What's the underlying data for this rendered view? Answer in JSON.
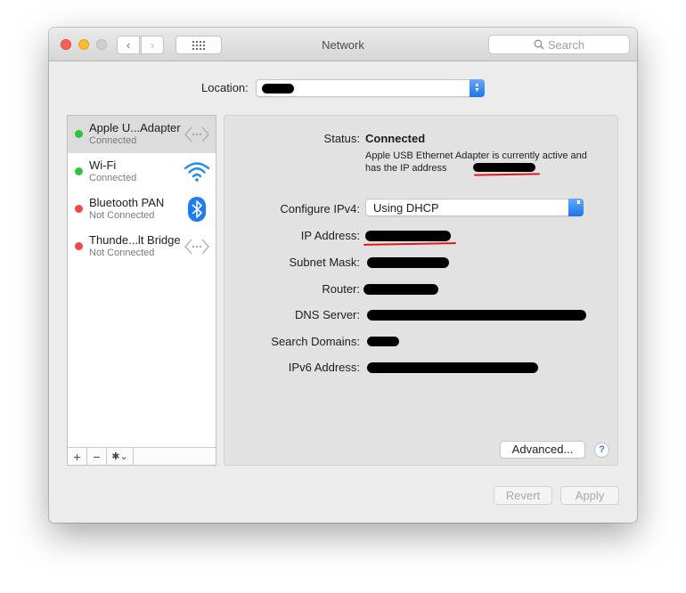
{
  "window": {
    "title": "Network"
  },
  "toolbar": {
    "search_placeholder": "Search",
    "back_glyph": "‹",
    "forward_glyph": "›"
  },
  "location": {
    "label": "Location:"
  },
  "services": [
    {
      "name": "Apple U...Adapter",
      "status": "Connected",
      "status_color": "#2fc23e",
      "icon": "ethernet-icon"
    },
    {
      "name": "Wi-Fi",
      "status": "Connected",
      "status_color": "#2fc23e",
      "icon": "wifi-icon"
    },
    {
      "name": "Bluetooth PAN",
      "status": "Not Connected",
      "status_color": "#f2464a",
      "icon": "bluetooth-icon"
    },
    {
      "name": "Thunde...lt Bridge",
      "status": "Not Connected",
      "status_color": "#f2464a",
      "icon": "ethernet-icon"
    }
  ],
  "sidebar_footer": {
    "add": "+",
    "remove": "−",
    "gear": "✱⌄"
  },
  "details": {
    "status_label": "Status:",
    "status_value": "Connected",
    "status_desc": "Apple USB Ethernet Adapter is currently active and has the IP address",
    "configure_label": "Configure IPv4:",
    "configure_value": "Using DHCP",
    "ip_label": "IP Address:",
    "subnet_label": "Subnet Mask:",
    "router_label": "Router:",
    "dns_label": "DNS Server:",
    "search_domains_label": "Search Domains:",
    "ipv6_label": "IPv6 Address:",
    "advanced_label": "Advanced...",
    "help_label": "?"
  },
  "footer": {
    "revert_label": "Revert",
    "apply_label": "Apply"
  },
  "colors": {
    "accent": "#1a74ec",
    "connected": "#2fc23e",
    "disconnected": "#f2464a",
    "annotation": "#e0191e"
  }
}
